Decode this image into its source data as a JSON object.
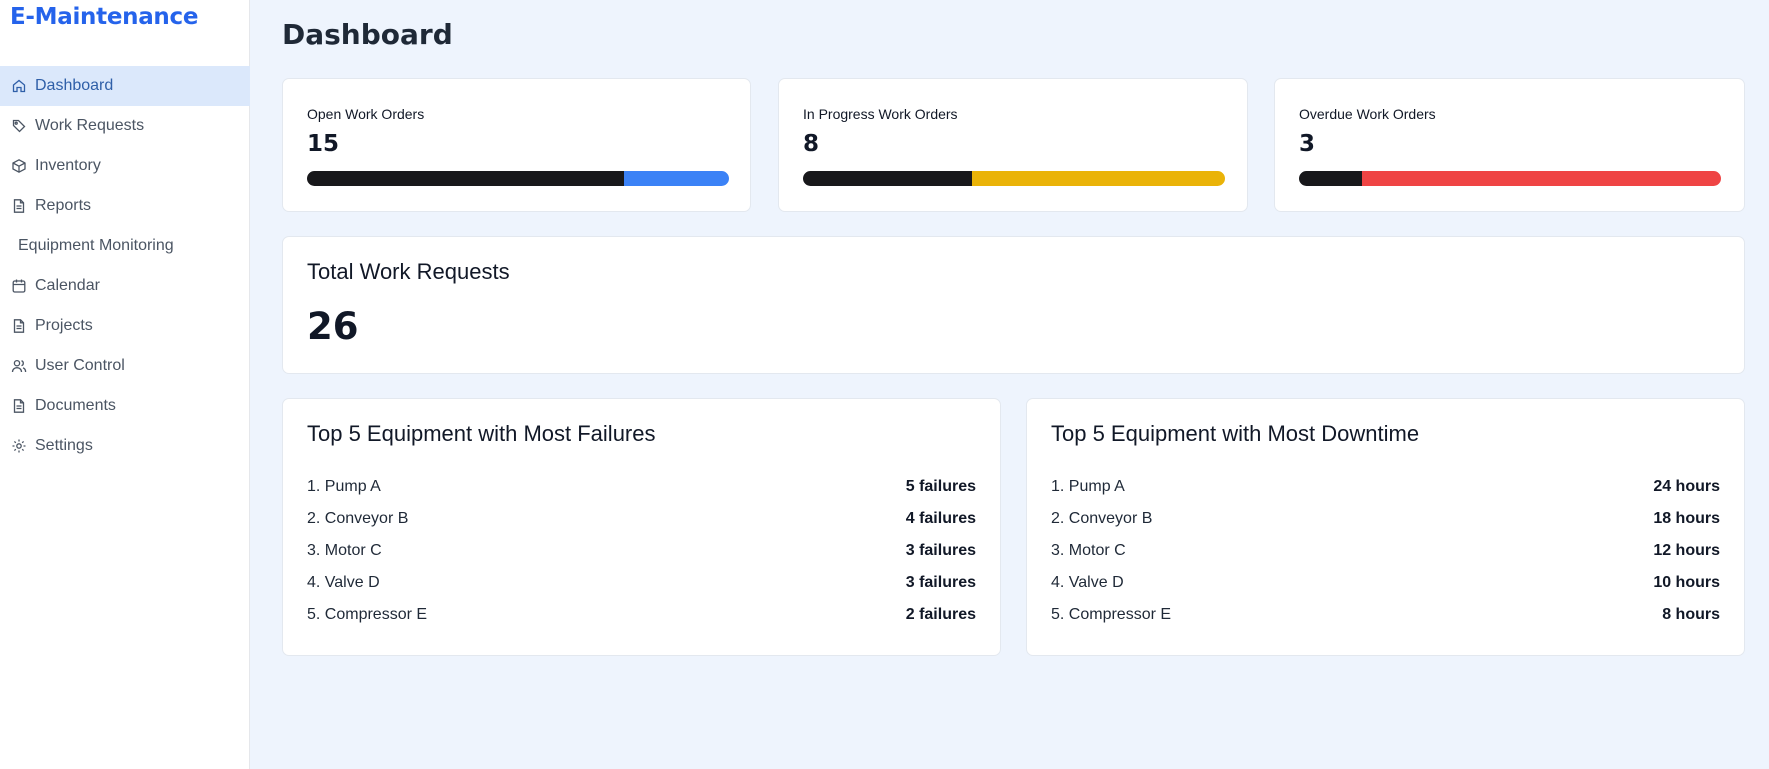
{
  "app": {
    "brand": "E-Maintenance"
  },
  "sidebar": {
    "items": [
      {
        "label": "Dashboard",
        "icon": "home-icon"
      },
      {
        "label": "Work Requests",
        "icon": "tag-icon"
      },
      {
        "label": "Inventory",
        "icon": "package-icon"
      },
      {
        "label": "Reports",
        "icon": "file-icon"
      },
      {
        "label": "Equipment Monitoring",
        "icon": ""
      },
      {
        "label": "Calendar",
        "icon": "calendar-icon"
      },
      {
        "label": "Projects",
        "icon": "file-icon"
      },
      {
        "label": "User Control",
        "icon": "users-icon"
      },
      {
        "label": "Documents",
        "icon": "file-icon"
      },
      {
        "label": "Settings",
        "icon": "gear-icon"
      }
    ],
    "active": "Dashboard"
  },
  "page": {
    "title": "Dashboard"
  },
  "stats": [
    {
      "label": "Open Work Orders",
      "value": "15",
      "progress": 0.75,
      "color": "#3b82f6"
    },
    {
      "label": "In Progress Work Orders",
      "value": "8",
      "progress": 0.4,
      "color": "#eab308"
    },
    {
      "label": "Overdue Work Orders",
      "value": "3",
      "progress": 0.15,
      "color": "#ef4444"
    }
  ],
  "total": {
    "title": "Total Work Requests",
    "value": "26"
  },
  "failures": {
    "title": "Top 5 Equipment with Most Failures",
    "rows": [
      {
        "name": "1. Pump A",
        "value": "5 failures"
      },
      {
        "name": "2. Conveyor B",
        "value": "4 failures"
      },
      {
        "name": "3. Motor C",
        "value": "3 failures"
      },
      {
        "name": "4. Valve D",
        "value": "3 failures"
      },
      {
        "name": "5. Compressor E",
        "value": "2 failures"
      }
    ]
  },
  "downtime": {
    "title": "Top 5 Equipment with Most Downtime",
    "rows": [
      {
        "name": "1. Pump A",
        "value": "24 hours"
      },
      {
        "name": "2. Conveyor B",
        "value": "18 hours"
      },
      {
        "name": "3. Motor C",
        "value": "12 hours"
      },
      {
        "name": "4. Valve D",
        "value": "10 hours"
      },
      {
        "name": "5. Compressor E",
        "value": "8 hours"
      }
    ]
  }
}
